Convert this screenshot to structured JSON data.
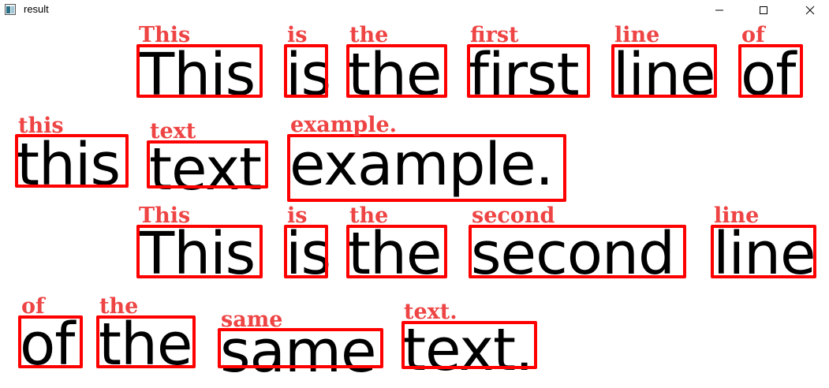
{
  "window": {
    "title": "result",
    "icon": "app-icon",
    "controls": [
      "minimize-icon",
      "maximize-icon",
      "close-icon"
    ]
  },
  "colors": {
    "box": "#ff0000",
    "label": "#ee4444",
    "text": "#000000"
  },
  "lines": [
    {
      "words": [
        {
          "text": "This",
          "label": "This"
        },
        {
          "text": "is",
          "label": "is"
        },
        {
          "text": "the",
          "label": "the"
        },
        {
          "text": "first",
          "label": "first"
        },
        {
          "text": "line",
          "label": "line"
        },
        {
          "text": "of",
          "label": "of"
        }
      ]
    },
    {
      "words": [
        {
          "text": "this",
          "label": "this"
        },
        {
          "text": "text",
          "label": "text"
        },
        {
          "text": "example.",
          "label": "example."
        }
      ]
    },
    {
      "words": [
        {
          "text": "This",
          "label": "This"
        },
        {
          "text": "is",
          "label": "is"
        },
        {
          "text": "the",
          "label": "the"
        },
        {
          "text": "second",
          "label": "second"
        },
        {
          "text": "line",
          "label": "line"
        }
      ]
    },
    {
      "words": [
        {
          "text": "of",
          "label": "of"
        },
        {
          "text": "the",
          "label": "the"
        },
        {
          "text": "same",
          "label": "same"
        },
        {
          "text": "text.",
          "label": "text."
        }
      ]
    }
  ]
}
